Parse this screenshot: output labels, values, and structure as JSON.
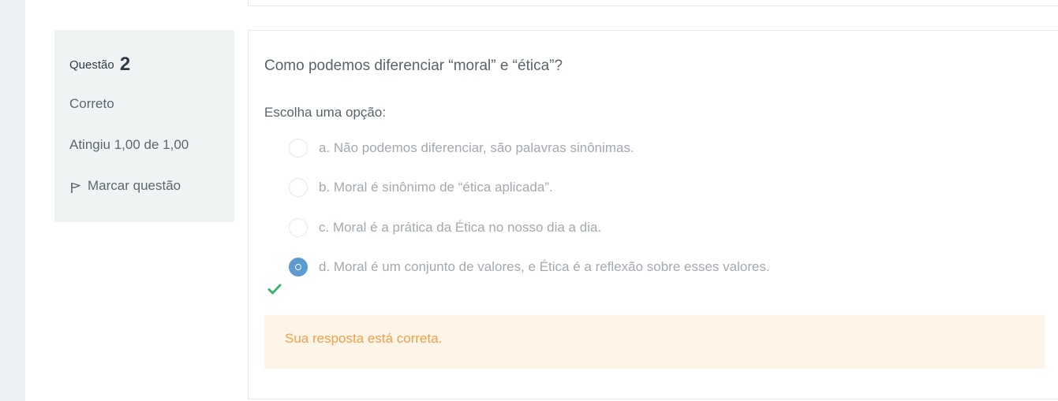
{
  "question_info": {
    "label": "Questão",
    "number": "2",
    "state": "Correto",
    "grade": "Atingiu 1,00 de 1,00",
    "flag_label": "Marcar questão",
    "flag_icon": "flag-icon"
  },
  "question": {
    "text": "Como podemos diferenciar “moral” e “ética”?",
    "prompt": "Escolha uma opção:",
    "options": [
      {
        "label": "a. Não podemos diferenciar, são palavras sinônimas.",
        "selected": false
      },
      {
        "label": "b. Moral é sinônimo de “ética aplicada”.",
        "selected": false
      },
      {
        "label": "c. Moral é a prática da Ética no nosso dia a dia.",
        "selected": false
      },
      {
        "label": "d. Moral é um conjunto de valores, e Ética é a reflexão sobre esses valores.",
        "selected": true
      }
    ],
    "correct_icon": "check-icon",
    "feedback": "Sua resposta está correta."
  },
  "colors": {
    "accent": "#5b9bd1",
    "correct": "#3cb371",
    "feedback_bg": "#fff4e8",
    "feedback_text": "#f0a04b"
  }
}
